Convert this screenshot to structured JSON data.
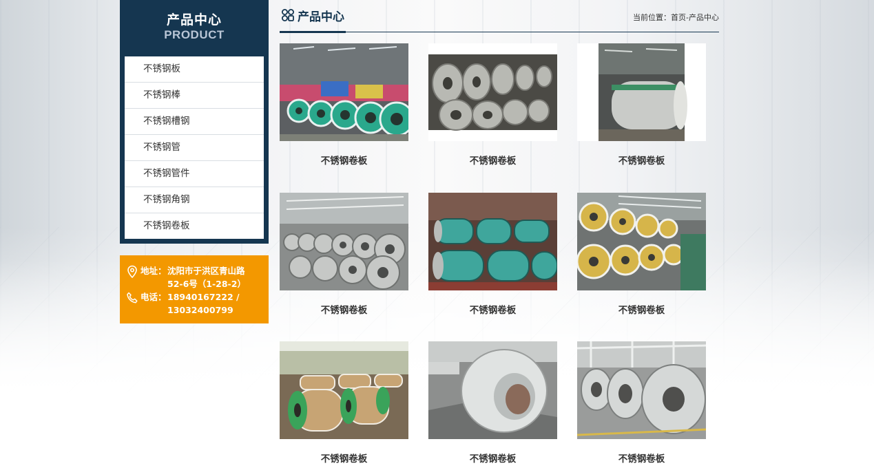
{
  "sidebar": {
    "title": "产品中心",
    "subtitle": "PRODUCT",
    "items": [
      {
        "label": "不锈钢板"
      },
      {
        "label": "不锈钢棒"
      },
      {
        "label": "不锈钢槽钢"
      },
      {
        "label": "不锈钢管"
      },
      {
        "label": "不锈钢管件"
      },
      {
        "label": "不锈钢角钢"
      },
      {
        "label": "不锈钢卷板"
      }
    ]
  },
  "contact": {
    "address_label": "地址：",
    "address_line1": "沈阳市于洪区青山路",
    "address_line2": "52-6号（1-28-2）",
    "phone_label": "电话：",
    "phone_line1": "18940167222 /",
    "phone_line2": "13032400799",
    "icons": [
      "location-pin-icon",
      "phone-icon"
    ]
  },
  "main": {
    "title": "产品中心",
    "title_icon": "grid-icon",
    "breadcrumb": "当前位置：首页-产品中心",
    "products": [
      {
        "name": "不锈钢卷板"
      },
      {
        "name": "不锈钢卷板"
      },
      {
        "name": "不锈钢卷板"
      },
      {
        "name": "不锈钢卷板"
      },
      {
        "name": "不锈钢卷板"
      },
      {
        "name": "不锈钢卷板"
      },
      {
        "name": "不锈钢卷板"
      },
      {
        "name": "不锈钢卷板"
      },
      {
        "name": "不锈钢卷板"
      }
    ]
  },
  "colors": {
    "navy": "#153650",
    "orange": "#f39800",
    "text": "#333333"
  }
}
